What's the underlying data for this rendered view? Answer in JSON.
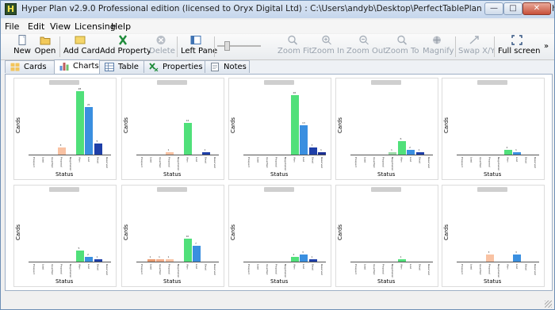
{
  "window": {
    "title": "Hyper Plan v2.9.0 Professional edition (licensed to Oryx Digital Ltd) : C:\\Users\\andyb\\Desktop\\PerfectTablePlan sales pipeline 2.hp",
    "icon_letter": "H",
    "controls": {
      "minimize": "—",
      "maximize": "□",
      "close": "✕"
    }
  },
  "menu": [
    "File",
    "Edit",
    "View",
    "Licensing",
    "Help"
  ],
  "toolbar": {
    "new": "New",
    "open": "Open",
    "add_card": "Add Card",
    "add_property": "Add Property",
    "delete": "Delete",
    "left_pane": "Left Pane",
    "zoom_fit": "Zoom Fit",
    "zoom_in": "Zoom In",
    "zoom_out": "Zoom Out",
    "zoom_to": "Zoom To",
    "magnify": "Magnify",
    "swap_xy": "Swap X/Y",
    "full_screen": "Full screen",
    "more": "»"
  },
  "tabs": [
    "Cards",
    "Charts",
    "Table",
    "Properties",
    "Notes"
  ],
  "active_tab": "Charts",
  "colors": {
    "prospect": "#5da4e8",
    "lead": "#e89a6f",
    "qualified": "#f2ad8a",
    "proposal": "#f9c2a3",
    "negotiation": "#9bd9a7",
    "won": "#50e07a",
    "lost": "#3a8fe0",
    "dead": "#1e3fa8",
    "reserved": "#1b2f92"
  },
  "chart_common": {
    "y_label": "Cards",
    "x_label": "Status",
    "categories": [
      "Prospect",
      "Lead",
      "Qualified",
      "Proposal",
      "Negotiation",
      "Won",
      "Lost",
      "Dead",
      "Reserved"
    ]
  },
  "chart_data": [
    {
      "type": "bar",
      "xlabel": "Status",
      "ylabel": "Cards",
      "values": [
        0,
        0,
        0,
        3,
        0,
        28,
        21,
        5,
        0
      ],
      "value_labels": [
        "",
        "",
        "",
        "3",
        "",
        "28",
        "21",
        "5",
        ""
      ]
    },
    {
      "type": "bar",
      "xlabel": "Status",
      "ylabel": "Cards",
      "values": [
        0,
        0,
        0,
        1,
        0,
        14,
        0,
        1,
        0
      ],
      "value_labels": [
        "",
        "",
        "",
        "1",
        "",
        "14",
        "",
        "1",
        ""
      ]
    },
    {
      "type": "bar",
      "xlabel": "Status",
      "ylabel": "Cards",
      "values": [
        0,
        0,
        0,
        0,
        0,
        26,
        13,
        3,
        1
      ],
      "value_labels": [
        "",
        "",
        "",
        "",
        "",
        "26",
        "13",
        "3",
        "1"
      ]
    },
    {
      "type": "bar",
      "xlabel": "Status",
      "ylabel": "Cards",
      "values": [
        0,
        0,
        0,
        0,
        1,
        6,
        2,
        1,
        0
      ],
      "value_labels": [
        "",
        "",
        "",
        "",
        "1",
        "6",
        "2",
        "1",
        ""
      ]
    },
    {
      "type": "bar",
      "xlabel": "Status",
      "ylabel": "Cards",
      "values": [
        0,
        0,
        0,
        0,
        0,
        2,
        1,
        0,
        0
      ],
      "value_labels": [
        "",
        "",
        "",
        "",
        "",
        "2",
        "1",
        "",
        ""
      ]
    },
    {
      "type": "bar",
      "xlabel": "Status",
      "ylabel": "Cards",
      "values": [
        0,
        0,
        0,
        0,
        0,
        5,
        2,
        1,
        0
      ],
      "value_labels": [
        "",
        "",
        "",
        "",
        "",
        "5",
        "2",
        "1",
        ""
      ]
    },
    {
      "type": "bar",
      "xlabel": "Status",
      "ylabel": "Cards",
      "values": [
        0,
        1,
        1,
        1,
        0,
        10,
        7,
        0,
        0
      ],
      "value_labels": [
        "",
        "1",
        "1",
        "1",
        "",
        "10",
        "7",
        "",
        ""
      ]
    },
    {
      "type": "bar",
      "xlabel": "Status",
      "ylabel": "Cards",
      "values": [
        0,
        0,
        0,
        0,
        0,
        2,
        3,
        1,
        0
      ],
      "value_labels": [
        "",
        "",
        "",
        "",
        "",
        "2",
        "3",
        "1",
        ""
      ]
    },
    {
      "type": "bar",
      "xlabel": "Status",
      "ylabel": "Cards",
      "values": [
        0,
        0,
        0,
        0,
        0,
        1,
        0,
        0,
        0
      ],
      "value_labels": [
        "",
        "",
        "",
        "",
        "",
        "1",
        "",
        "",
        ""
      ]
    },
    {
      "type": "bar",
      "xlabel": "Status",
      "ylabel": "Cards",
      "values": [
        0,
        0,
        0,
        3,
        0,
        0,
        3,
        0,
        0
      ],
      "value_labels": [
        "",
        "",
        "",
        "3",
        "",
        "",
        "3",
        "",
        ""
      ]
    }
  ]
}
